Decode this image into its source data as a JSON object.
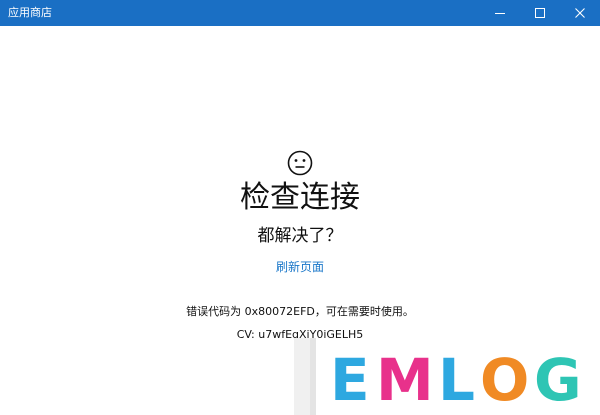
{
  "window": {
    "title": "应用商店",
    "titlebar_color": "#1a6fc4"
  },
  "error_page": {
    "face_icon": "neutral-face-icon",
    "heading": "检查连接",
    "subheading": "都解决了？",
    "refresh_link": "刷新页面",
    "error_message": "错误代码为 0x80072EFD，可在需要时使用。",
    "cv_code": "CV: u7wfEqXiY0iGELH5",
    "link_color": "#1a77c9"
  },
  "watermark": {
    "text": "EMLOG",
    "letters": [
      "E",
      "M",
      "L",
      "O",
      "G"
    ],
    "colors": [
      "#2ea8e0",
      "#e8318b",
      "#2ea8e0",
      "#f08a24",
      "#2ec5b4"
    ]
  }
}
